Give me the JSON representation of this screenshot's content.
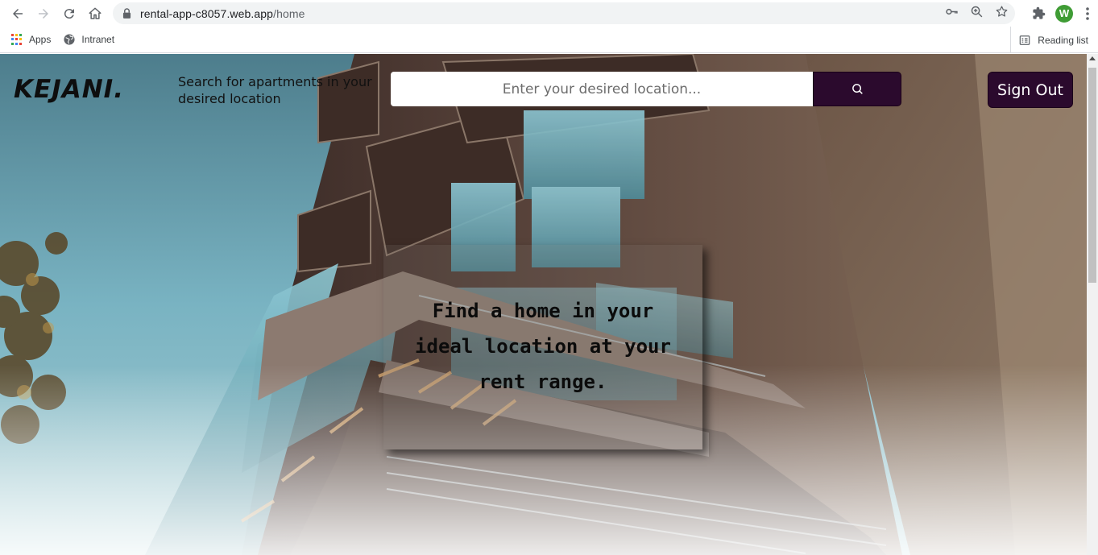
{
  "browser": {
    "url_host": "rental-app-c8057.web.app",
    "url_path": "/home",
    "avatar_letter": "W",
    "icons": [
      "back-icon",
      "forward-icon",
      "reload-icon",
      "home-icon",
      "lock-icon",
      "key-icon",
      "zoom-icon",
      "star-icon",
      "extensions-icon",
      "menu-icon"
    ]
  },
  "bookmarks": {
    "items": [
      {
        "label": "Apps",
        "icon": "apps-grid-icon"
      },
      {
        "label": "Intranet",
        "icon": "globe-icon"
      }
    ],
    "reading_list": "Reading list"
  },
  "page": {
    "logo": "KEJANI.",
    "tagline": "Search for apartments in your desired location",
    "search": {
      "placeholder": "Enter your desired location...",
      "value": "",
      "button_icon": "search-icon"
    },
    "signout_label": "Sign Out",
    "hero_text": "Find a home in your ideal location at your rent range."
  },
  "colors": {
    "accent": "#2b0a2d",
    "avatar": "#3f9c35"
  }
}
